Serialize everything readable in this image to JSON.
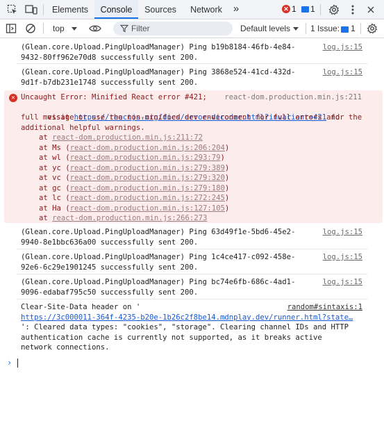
{
  "tabs": {
    "items": [
      "Elements",
      "Console",
      "Sources",
      "Network"
    ],
    "more": "»",
    "errors_count": "1",
    "messages_count": "1"
  },
  "toolbar": {
    "context": "top",
    "filter_placeholder": "Filter",
    "levels": "Default levels",
    "issues_label": "1 Issue:",
    "issues_count": "1"
  },
  "entries": [
    {
      "lines": [
        "(Glean.core.Upload.PingUploadManager) Ping b19b8184-46fb-4e84-",
        "9432-80ff962e70d8 successfully sent 200."
      ],
      "source": "log.js:15"
    },
    {
      "lines": [
        "(Glean.core.Upload.PingUploadManager) Ping 3868e524-41cd-432d-",
        "9d1f-b7db231e1748 successfully sent 200."
      ],
      "source": "log.js:15"
    }
  ],
  "error": {
    "head": "Uncaught Error: Minified React error #421;",
    "source": "react-dom.production.min.js:211",
    "visit": "visit ",
    "url": "https://reactjs.org/docs/error-decoder.html?invariant=421",
    "after_url": " for the",
    "rest": [
      "full message or use the non-minified dev environment for full errors and",
      "additional helpful warnings."
    ],
    "stack": [
      {
        "fn": "at ",
        "loc": "react-dom.production.min.js:211:72",
        "paren": false
      },
      {
        "fn": "at Ms (",
        "loc": "react-dom.production.min.js:206:204",
        "paren": true
      },
      {
        "fn": "at wl (",
        "loc": "react-dom.production.min.js:293:79",
        "paren": true
      },
      {
        "fn": "at yc (",
        "loc": "react-dom.production.min.js:279:389",
        "paren": true
      },
      {
        "fn": "at vc (",
        "loc": "react-dom.production.min.js:279:320",
        "paren": true
      },
      {
        "fn": "at gc (",
        "loc": "react-dom.production.min.js:279:180",
        "paren": true
      },
      {
        "fn": "at lc (",
        "loc": "react-dom.production.min.js:272:245",
        "paren": true
      },
      {
        "fn": "at Ha (",
        "loc": "react-dom.production.min.js:127:105",
        "paren": true
      },
      {
        "fn": "at ",
        "loc": "react-dom.production.min.js:266:273",
        "paren": false
      }
    ]
  },
  "entries2": [
    {
      "lines": [
        "(Glean.core.Upload.PingUploadManager) Ping 63d49f1e-5bd6-45e2-",
        "9940-8e1bbc636a00 successfully sent 200."
      ],
      "source": "log.js:15"
    },
    {
      "lines": [
        "(Glean.core.Upload.PingUploadManager) Ping 1c4ce417-c092-458e-",
        "92e6-6c29e1901245 successfully sent 200."
      ],
      "source": "log.js:15"
    },
    {
      "lines": [
        "(Glean.core.Upload.PingUploadManager) Ping bc74e6fb-686c-4ad1-",
        "9096-edabaf795c50 successfully sent 200."
      ],
      "source": "log.js:15"
    }
  ],
  "csd": {
    "head": "Clear-Site-Data header on '",
    "source": "random#sintaxis:1",
    "url": "https://3c000011-364f-4235-b20e-1b26c2f8be14.mdnplay.dev/runner.html?state…",
    "rest": [
      "': Cleared data types: \"cookies\", \"storage\". Clearing channel IDs and HTTP",
      "authentication cache is currently not supported, as it breaks active",
      "network connections."
    ]
  },
  "prompt_symbol": "›"
}
